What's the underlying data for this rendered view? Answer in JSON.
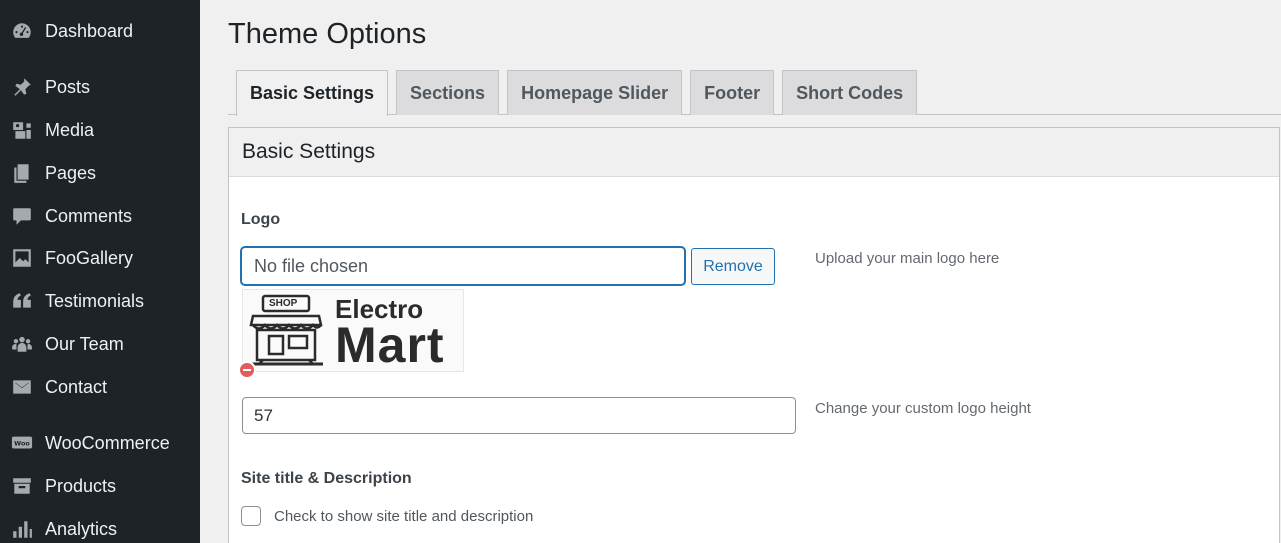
{
  "sidebar": {
    "items": [
      {
        "label": "Dashboard",
        "icon": "dashboard-icon"
      },
      {
        "label": "Posts",
        "icon": "pin-icon"
      },
      {
        "label": "Media",
        "icon": "media-icon"
      },
      {
        "label": "Pages",
        "icon": "pages-icon"
      },
      {
        "label": "Comments",
        "icon": "comment-icon"
      },
      {
        "label": "FooGallery",
        "icon": "gallery-icon"
      },
      {
        "label": "Testimonials",
        "icon": "quote-icon"
      },
      {
        "label": "Our Team",
        "icon": "groups-icon"
      },
      {
        "label": "Contact",
        "icon": "envelope-icon"
      },
      {
        "label": "WooCommerce",
        "icon": "woo-icon"
      },
      {
        "label": "Products",
        "icon": "archive-icon"
      },
      {
        "label": "Analytics",
        "icon": "bar-chart-icon"
      }
    ],
    "background": "#1d2327"
  },
  "page": {
    "title": "Theme Options"
  },
  "tabs": [
    {
      "label": "Basic Settings",
      "active": true
    },
    {
      "label": "Sections",
      "active": false
    },
    {
      "label": "Homepage Slider",
      "active": false
    },
    {
      "label": "Footer",
      "active": false
    },
    {
      "label": "Short Codes",
      "active": false
    }
  ],
  "panel": {
    "title": "Basic Settings",
    "logo": {
      "label": "Logo",
      "file_value": "No file chosen",
      "remove_label": "Remove",
      "help": "Upload your main logo here",
      "preview": {
        "shop_text": "SHOP",
        "word1": "Electro",
        "word2": "Mart"
      }
    },
    "logo_height": {
      "value": "57",
      "help": "Change your custom logo height"
    },
    "site_title": {
      "label": "Site title & Description",
      "checkbox_label": "Check to show site title and description",
      "checked": false
    }
  },
  "colors": {
    "accent": "#2271b1",
    "remove_red": "#e25c5c"
  }
}
